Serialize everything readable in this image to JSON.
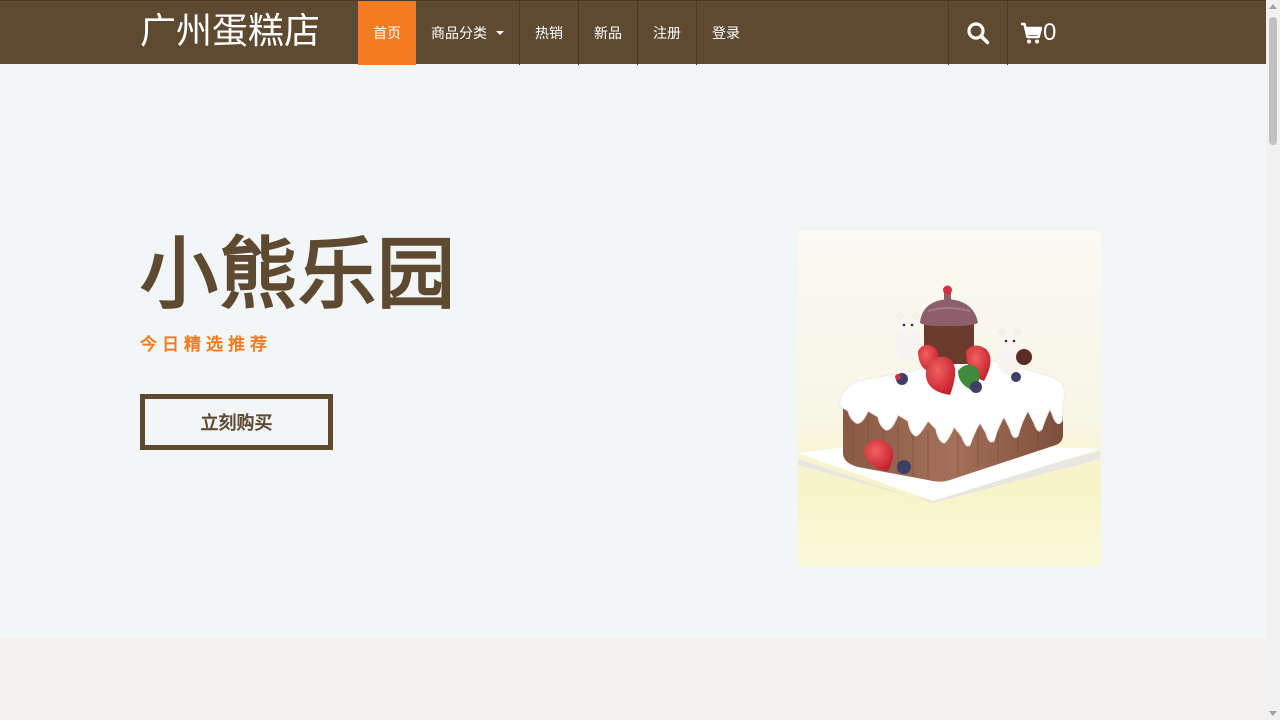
{
  "brand": {
    "name": "广州蛋糕店"
  },
  "nav": {
    "items": [
      {
        "label": "首页",
        "active": true
      },
      {
        "label": "商品分类",
        "dropdown": true
      },
      {
        "label": "热销"
      },
      {
        "label": "新品"
      },
      {
        "label": "注册"
      },
      {
        "label": "登录"
      }
    ],
    "cart_count": "0",
    "icons": [
      "search-icon",
      "cart-icon"
    ]
  },
  "hero": {
    "title": "小熊乐园",
    "subtitle": "今日精选推荐",
    "button_label": "立刻购买"
  },
  "colors": {
    "nav_bg": "#5e4931",
    "accent": "#f47b20",
    "page_bg": "#f3f6f7",
    "brown_text": "#5e4931"
  }
}
